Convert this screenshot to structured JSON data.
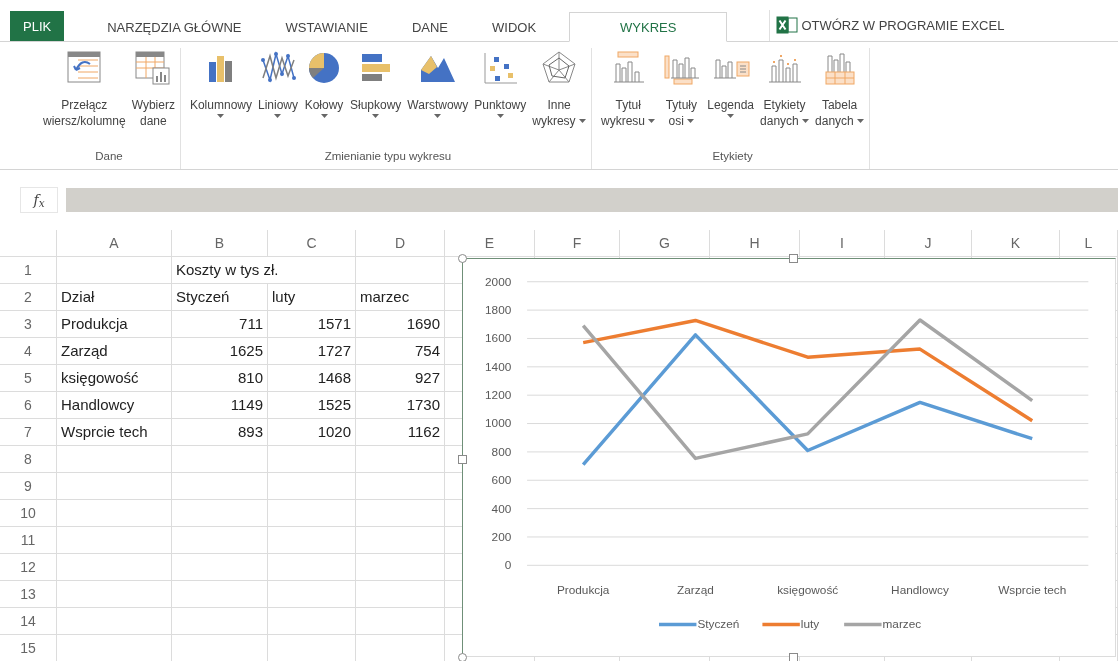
{
  "ribbon_tabs": [
    {
      "label": "PLIK",
      "kind": "file",
      "selected": false
    },
    {
      "label": "NARZĘDZIA GŁÓWNE",
      "kind": "tab",
      "selected": false
    },
    {
      "label": "WSTAWIANIE",
      "kind": "tab",
      "selected": false
    },
    {
      "label": "DANE",
      "kind": "tab",
      "selected": false
    },
    {
      "label": "WIDOK",
      "kind": "tab",
      "selected": false
    },
    {
      "label": "WYKRES",
      "kind": "tab",
      "selected": true
    }
  ],
  "open_in_excel": {
    "label": "OTWÓRZ W PROGRAMIE EXCEL"
  },
  "ribbon_groups": [
    {
      "label": "Dane",
      "buttons": [
        {
          "label": "Przełącz\nwiersz/kolumnę",
          "dropdown": false
        },
        {
          "label": "Wybierz\ndane",
          "dropdown": false
        }
      ]
    },
    {
      "label": "Zmienianie typu wykresu",
      "buttons": [
        {
          "label": "Kolumnowy",
          "dropdown": true
        },
        {
          "label": "Liniowy",
          "dropdown": true
        },
        {
          "label": "Kołowy",
          "dropdown": true
        },
        {
          "label": "Słupkowy",
          "dropdown": true
        },
        {
          "label": "Warstwowy",
          "dropdown": true
        },
        {
          "label": "Punktowy",
          "dropdown": true
        },
        {
          "label": "Inne\nwykresy",
          "dropdown": true
        }
      ]
    },
    {
      "label": "Etykiety",
      "buttons": [
        {
          "label": "Tytuł\nwykresu",
          "dropdown": true
        },
        {
          "label": "Tytuły\nosi",
          "dropdown": true
        },
        {
          "label": "Legenda",
          "dropdown": true
        },
        {
          "label": "Etykiety\ndanych",
          "dropdown": true
        },
        {
          "label": "Tabela\ndanych",
          "dropdown": true
        }
      ]
    }
  ],
  "formula_bar": {
    "function_label": "f$_{x}$"
  },
  "sheet": {
    "columns": [
      "A",
      "B",
      "C",
      "D",
      "E",
      "F",
      "G",
      "H",
      "I",
      "J",
      "K",
      "L"
    ],
    "rows": [
      {
        "number": "1",
        "cells": [
          "",
          "Koszty w tys zł.",
          "",
          ""
        ]
      },
      {
        "number": "2",
        "cells": [
          "Dział",
          "Styczeń",
          "luty",
          "marzec"
        ]
      },
      {
        "number": "3",
        "cells": [
          "Produkcja",
          "711",
          "1571",
          "1690"
        ]
      },
      {
        "number": "4",
        "cells": [
          "Zarząd",
          "1625",
          "1727",
          "754"
        ]
      },
      {
        "number": "5",
        "cells": [
          "księgowość",
          "810",
          "1468",
          "927"
        ]
      },
      {
        "number": "6",
        "cells": [
          "Handlowcy",
          "1149",
          "1525",
          "1730"
        ]
      },
      {
        "number": "7",
        "cells": [
          "Wsprcie tech",
          "893",
          "1020",
          "1162"
        ]
      },
      {
        "number": "8",
        "cells": [
          "",
          "",
          "",
          ""
        ]
      },
      {
        "number": "9",
        "cells": [
          "",
          "",
          "",
          ""
        ]
      },
      {
        "number": "10",
        "cells": [
          "",
          "",
          "",
          ""
        ]
      },
      {
        "number": "11",
        "cells": [
          "",
          "",
          "",
          ""
        ]
      },
      {
        "number": "12",
        "cells": [
          "",
          "",
          "",
          ""
        ]
      },
      {
        "number": "13",
        "cells": [
          "",
          "",
          "",
          ""
        ]
      },
      {
        "number": "14",
        "cells": [
          "",
          "",
          "",
          ""
        ]
      },
      {
        "number": "15",
        "cells": [
          "",
          "",
          "",
          ""
        ]
      }
    ]
  },
  "chart": {
    "chart_data": {
      "type": "line",
      "categories": [
        "Produkcja",
        "Zarząd",
        "księgowość",
        "Handlowcy",
        "Wsprcie tech"
      ],
      "series": [
        {
          "name": "Styczeń",
          "color": "#5b9bd5",
          "values": [
            711,
            1625,
            810,
            1149,
            893
          ]
        },
        {
          "name": "luty",
          "color": "#ed7d31",
          "values": [
            1571,
            1727,
            1468,
            1525,
            1020
          ]
        },
        {
          "name": "marzec",
          "color": "#a5a5a5",
          "values": [
            1690,
            754,
            927,
            1730,
            1162
          ]
        }
      ],
      "grid": true,
      "legend": true,
      "ylim": [
        0,
        2000
      ],
      "yticks": [
        0,
        200,
        400,
        600,
        800,
        1000,
        1200,
        1400,
        1600,
        1800,
        2000
      ]
    }
  }
}
